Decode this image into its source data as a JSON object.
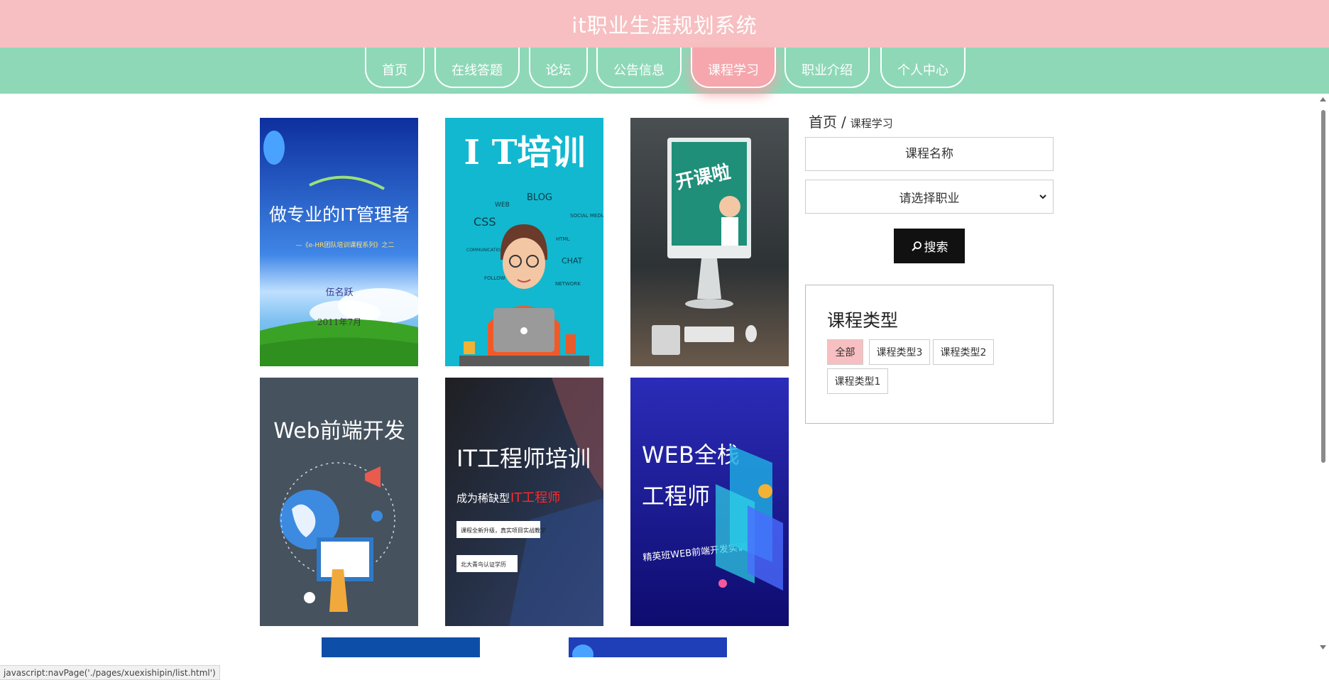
{
  "header": {
    "title": "it职业生涯规划系统"
  },
  "nav": {
    "items": [
      {
        "label": "首页"
      },
      {
        "label": "在线答题"
      },
      {
        "label": "论坛"
      },
      {
        "label": "公告信息"
      },
      {
        "label": "课程学习"
      },
      {
        "label": "职业介绍"
      },
      {
        "label": "个人中心"
      }
    ],
    "active": "课程学习"
  },
  "courses": [
    {
      "title": "做专业的IT管理者",
      "subtitle": "—《e-HR团队培训课程系列》之二",
      "author": "伍名跃",
      "date": "2011年7月"
    },
    {
      "title": "I T培训",
      "words": [
        "BLOG",
        "WEB",
        "CSS",
        "SOCIAL MEDIA",
        "HTML",
        "COMMUNICATIONS",
        "CHAT",
        "FOLLOW",
        "NETWORK"
      ]
    },
    {
      "title": "开课啦"
    },
    {
      "title": "Web前端开发"
    },
    {
      "title": "IT工程师培训",
      "line1": "成为稀缺型",
      "line1_highlight": "IT工程师",
      "box1": "课程全新升级，真实项目实战教学",
      "box2": "北大青鸟认证学历"
    },
    {
      "title_line1": "WEB全栈",
      "title_line2": "工程师",
      "subtitle": "精英班WEB前端开发实训"
    }
  ],
  "sidebar": {
    "breadcrumb_home": "首页",
    "breadcrumb_sep": "/",
    "breadcrumb_current": "课程学习",
    "search_placeholder": "课程名称",
    "select_value": "请选择职业",
    "search_button": "搜索",
    "type_title": "课程类型",
    "types": [
      {
        "label": "全部",
        "active": true
      },
      {
        "label": "课程类型3"
      },
      {
        "label": "课程类型2"
      },
      {
        "label": "课程类型1"
      }
    ]
  },
  "status_text": "javascript:navPage('./pages/xuexishipin/list.html')",
  "colors": {
    "header": "#f7bfc1",
    "nav": "#8ed8b7",
    "active": "#f5a7ad",
    "button": "#111111"
  }
}
